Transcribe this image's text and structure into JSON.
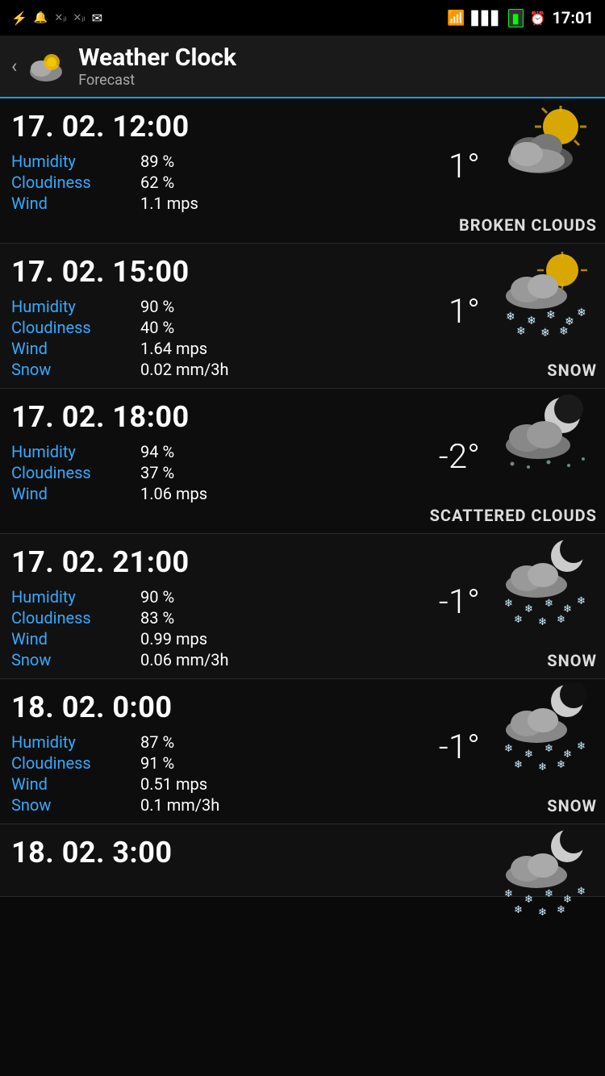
{
  "statusBar": {
    "time": "17:01",
    "icons_left": [
      "usb",
      "notification",
      "signal-x",
      "signal-x",
      "gmail"
    ],
    "icons_right": [
      "wifi",
      "signal",
      "battery",
      "alarm"
    ]
  },
  "header": {
    "back_label": "‹",
    "app_name": "Weather Clock",
    "subtitle": "Forecast"
  },
  "forecasts": [
    {
      "id": "f1",
      "datetime": "17. 02. 12:00",
      "humidity": "89 %",
      "cloudiness": "62 %",
      "wind": "1.1 mps",
      "snow": null,
      "temp": "1°",
      "condition": "BROKEN CLOUDS",
      "icon_type": "broken_clouds_day"
    },
    {
      "id": "f2",
      "datetime": "17. 02. 15:00",
      "humidity": "90 %",
      "cloudiness": "40 %",
      "wind": "1.64 mps",
      "snow": "0.02 mm/3h",
      "temp": "1°",
      "condition": "SNOW",
      "icon_type": "snow_day"
    },
    {
      "id": "f3",
      "datetime": "17. 02. 18:00",
      "humidity": "94 %",
      "cloudiness": "37 %",
      "wind": "1.06 mps",
      "snow": null,
      "temp": "-2°",
      "condition": "SCATTERED CLOUDS",
      "icon_type": "scattered_clouds_night"
    },
    {
      "id": "f4",
      "datetime": "17. 02. 21:00",
      "humidity": "90 %",
      "cloudiness": "83 %",
      "wind": "0.99 mps",
      "snow": "0.06 mm/3h",
      "temp": "-1°",
      "condition": "SNOW",
      "icon_type": "snow_night"
    },
    {
      "id": "f5",
      "datetime": "18. 02. 0:00",
      "humidity": "87 %",
      "cloudiness": "91 %",
      "wind": "0.51 mps",
      "snow": "0.1 mm/3h",
      "temp": "-1°",
      "condition": "SNOW",
      "icon_type": "snow_night"
    },
    {
      "id": "f6",
      "datetime": "18. 02. 3:00",
      "humidity": null,
      "cloudiness": null,
      "wind": null,
      "snow": null,
      "temp": null,
      "condition": null,
      "icon_type": "snow_night_partial"
    }
  ],
  "labels": {
    "humidity": "Humidity",
    "cloudiness": "Cloudiness",
    "wind": "Wind",
    "snow": "Snow"
  }
}
